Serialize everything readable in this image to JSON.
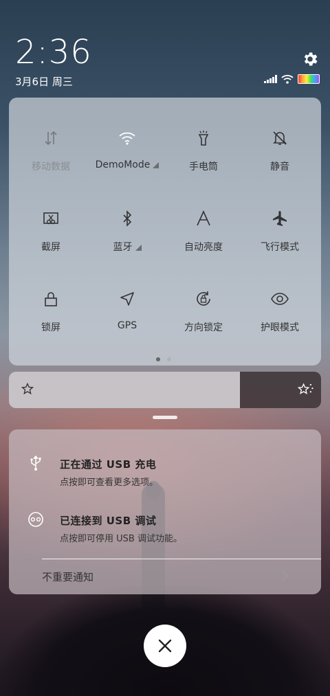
{
  "status": {
    "time": "2:36",
    "date": "3月6日 周三"
  },
  "quick_settings": {
    "tiles": [
      {
        "label": "移动数据",
        "icon": "mobile-data-icon",
        "state": "off"
      },
      {
        "label": "DemoMode",
        "icon": "wifi-icon",
        "state": "on"
      },
      {
        "label": "手电筒",
        "icon": "flashlight-icon",
        "state": "on"
      },
      {
        "label": "静音",
        "icon": "mute-bell-icon",
        "state": "on"
      },
      {
        "label": "截屏",
        "icon": "screenshot-icon",
        "state": "on"
      },
      {
        "label": "蓝牙",
        "icon": "bluetooth-icon",
        "state": "on"
      },
      {
        "label": "自动亮度",
        "icon": "auto-brightness-icon",
        "state": "on"
      },
      {
        "label": "飞行模式",
        "icon": "airplane-icon",
        "state": "on"
      },
      {
        "label": "锁屏",
        "icon": "lock-icon",
        "state": "on"
      },
      {
        "label": "GPS",
        "icon": "gps-arrow-icon",
        "state": "on"
      },
      {
        "label": "方向锁定",
        "icon": "rotation-lock-icon",
        "state": "on"
      },
      {
        "label": "护眼模式",
        "icon": "eye-icon",
        "state": "on"
      }
    ],
    "page_count": 2,
    "current_page": 1
  },
  "brightness": {
    "level": 0.74
  },
  "notifications": [
    {
      "title": "正在通过 USB 充电",
      "subtitle": "点按即可查看更多选项。",
      "icon": "usb-icon"
    },
    {
      "title": "已连接到 USB 调试",
      "subtitle": "点按即可停用 USB 调试功能。",
      "icon": "debug-icon"
    }
  ],
  "minor_notifications_label": "不重要通知",
  "colors": {
    "panel": "#cdd2da",
    "tile_text": "#333333",
    "disabled_text": "#8a8d92"
  }
}
